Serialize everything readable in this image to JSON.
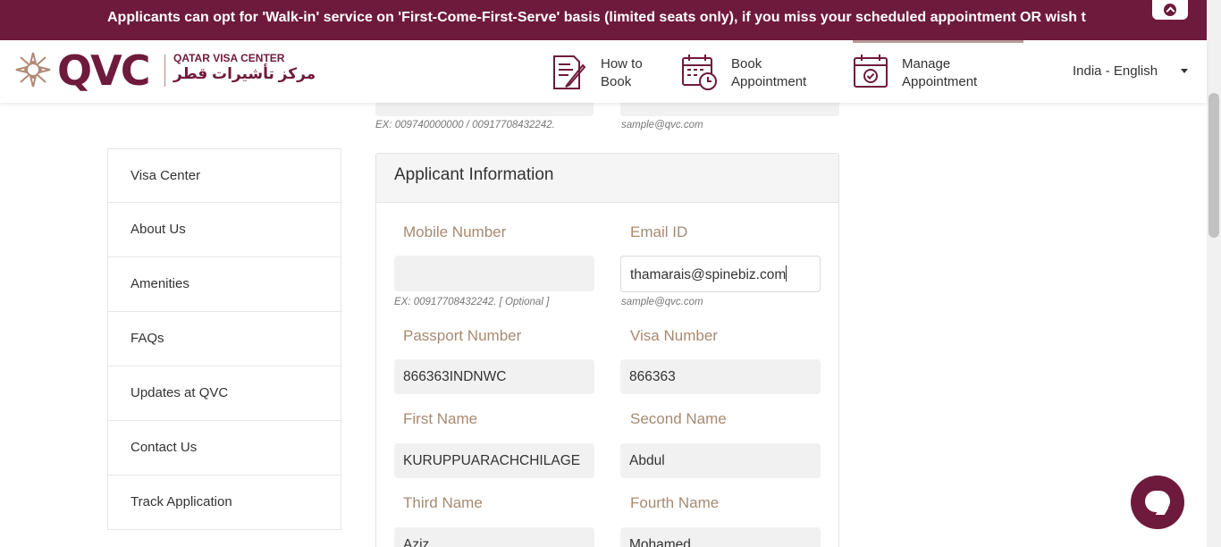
{
  "announcement": "Applicants can opt for 'Walk-in' service on 'First-Come-First-Serve' basis (limited seats only), if you miss your scheduled appointment OR wish to take the se",
  "logo": {
    "brand": "QVC",
    "english": "QATAR VISA CENTER",
    "arabic": "مركز تأشيرات قطر"
  },
  "nav": {
    "how_to_book": [
      "How to",
      "Book"
    ],
    "book_appointment": [
      "Book",
      "Appointment"
    ],
    "manage_appointment": [
      "Manage",
      "Appointment"
    ],
    "language": "India - English"
  },
  "sidebar": {
    "items": [
      {
        "label": "Visa Center"
      },
      {
        "label": "About Us"
      },
      {
        "label": "Amenities"
      },
      {
        "label": "FAQs"
      },
      {
        "label": "Updates at QVC"
      },
      {
        "label": "Contact Us"
      },
      {
        "label": "Track Application"
      }
    ]
  },
  "top_hints": {
    "phone_hint": "EX: 009740000000 / 00917708432242.",
    "email_hint": "sample@qvc.com"
  },
  "applicant": {
    "title": "Applicant Information",
    "mobile_label": "Mobile Number",
    "mobile_value": "",
    "mobile_hint": "EX: 00917708432242. [ Optional ]",
    "email_label": "Email ID",
    "email_value": "thamarais@spinebiz.com",
    "email_hint": "sample@qvc.com",
    "passport_label": "Passport Number",
    "passport_value": "866363INDNWC",
    "visa_label": "Visa Number",
    "visa_value": "866363",
    "first_name_label": "First Name",
    "first_name_value": "KURUPPUARACHCHILAGE",
    "second_name_label": "Second Name",
    "second_name_value": "Abdul",
    "third_name_label": "Third Name",
    "third_name_value": "Aziz",
    "fourth_name_label": "Fourth Name",
    "fourth_name_value": "Mohamed"
  },
  "colors": {
    "brand": "#6e1a3c",
    "label": "#a8896f",
    "input_bg": "#f1f1f1"
  }
}
